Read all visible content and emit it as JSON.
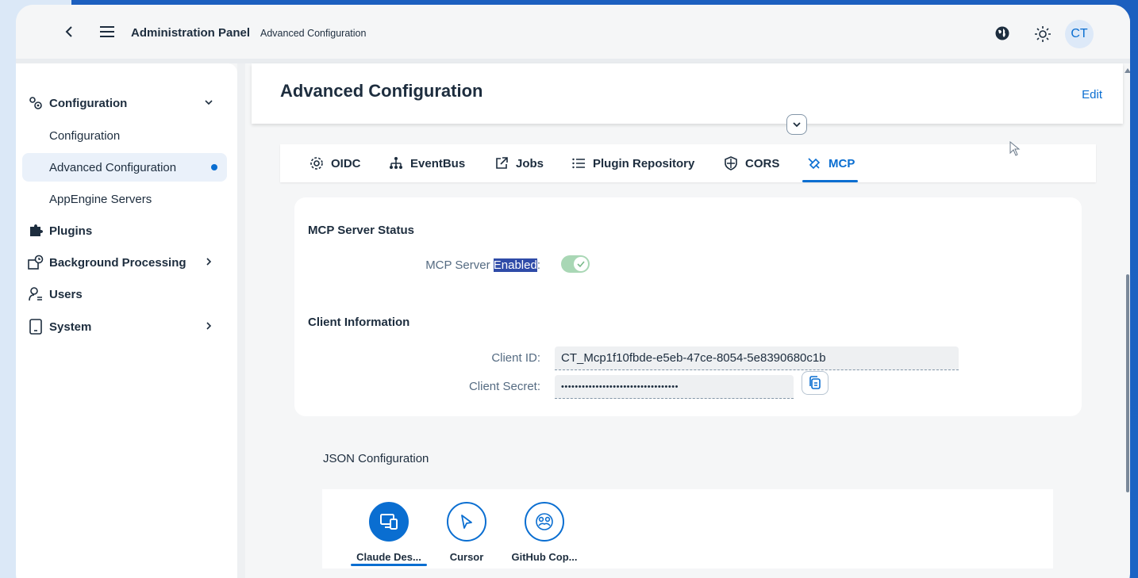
{
  "shell": {
    "title": "Administration Panel",
    "subtitle": "Advanced Configuration",
    "avatar": "CT"
  },
  "sidebar": {
    "items": [
      {
        "label": "Configuration",
        "icon": "gears-icon"
      },
      {
        "label": "Configuration"
      },
      {
        "label": "Advanced Configuration"
      },
      {
        "label": "AppEngine Servers"
      },
      {
        "label": "Plugins",
        "icon": "puzzle-icon"
      },
      {
        "label": "Background Processing",
        "icon": "background-process-icon"
      },
      {
        "label": "Users",
        "icon": "users-icon"
      },
      {
        "label": "System",
        "icon": "system-icon"
      }
    ]
  },
  "main": {
    "title": "Advanced Configuration",
    "edit": "Edit",
    "tabs": [
      {
        "label": "OIDC",
        "icon": "gear-icon"
      },
      {
        "label": "EventBus",
        "icon": "hierarchy-icon"
      },
      {
        "label": "Jobs",
        "icon": "external-link-icon"
      },
      {
        "label": "Plugin Repository",
        "icon": "list-icon"
      },
      {
        "label": "CORS",
        "icon": "shield-icon"
      },
      {
        "label": "MCP",
        "icon": "connector-icon"
      }
    ],
    "status": {
      "title": "MCP Server Status",
      "label_prefix": "MCP Server ",
      "label_highlight": "Enabled",
      "label_suffix": ":",
      "enabled": true
    },
    "client": {
      "title": "Client Information",
      "id_label": "Client ID:",
      "id_value": "CT_Mcp1f10fbde-e5eb-47ce-8054-5e8390680c1b",
      "secret_label": "Client Secret:",
      "secret_value": "••••••••••••••••••••••••••••••••••"
    },
    "json": {
      "label": "JSON Configuration",
      "clients": [
        {
          "label": "Claude Des...",
          "icon": "desktop-icon"
        },
        {
          "label": "Cursor",
          "icon": "cursor-icon"
        },
        {
          "label": "GitHub Cop...",
          "icon": "group-icon"
        }
      ]
    }
  },
  "colors": {
    "accent": "#0a6ed1",
    "background": "#1565c0",
    "toggle_on": "#a9d7b5"
  }
}
